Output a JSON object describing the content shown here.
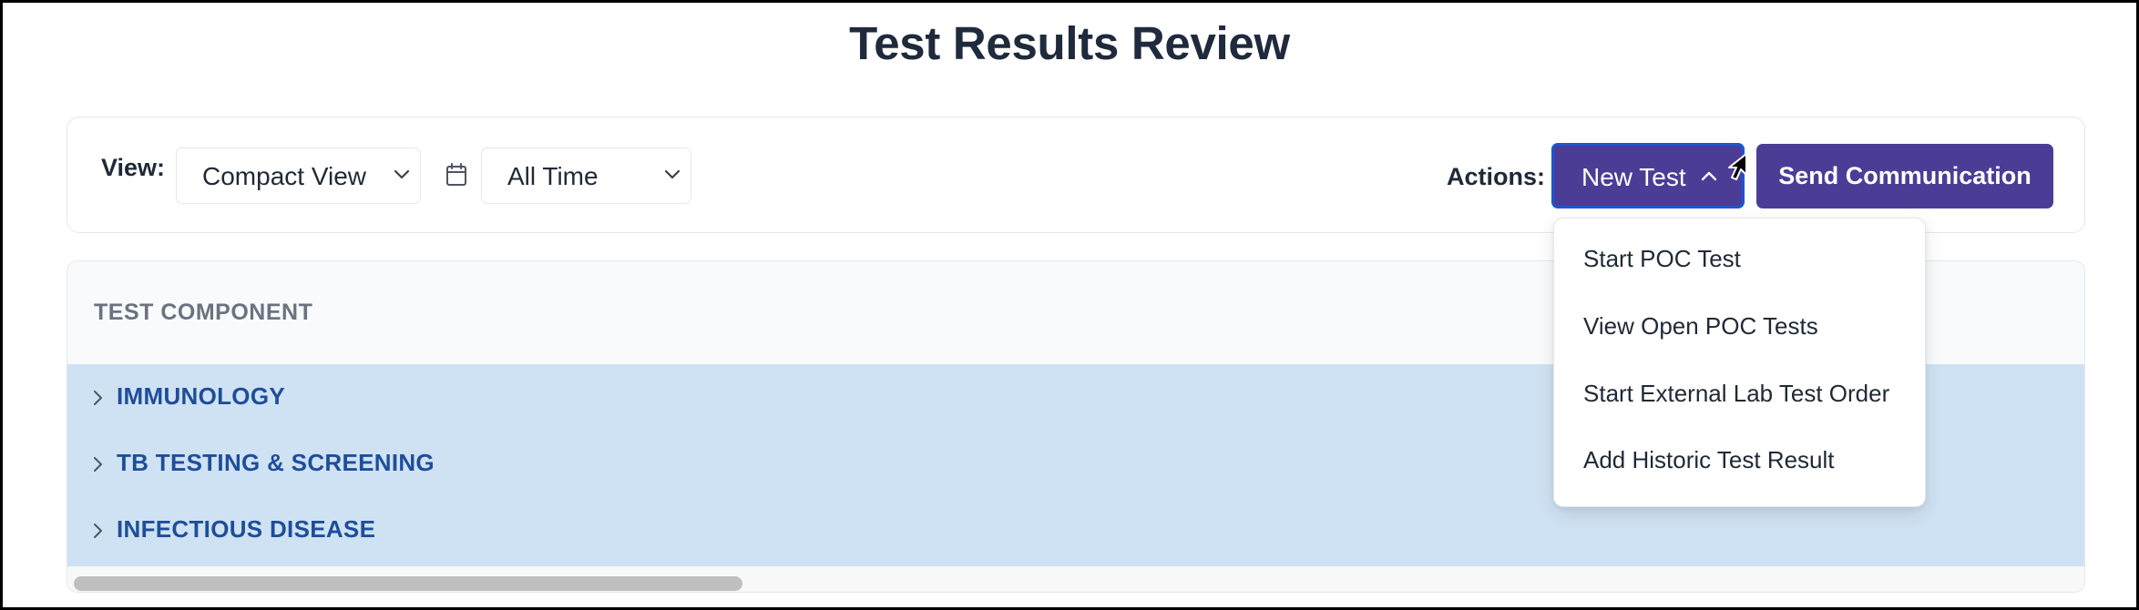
{
  "page": {
    "title": "Test Results Review"
  },
  "toolbar": {
    "view_label": "View:",
    "view_select": {
      "value": "Compact View",
      "icon": "chevron-down-icon"
    },
    "date_icon": "calendar-icon",
    "date_select": {
      "value": "All Time",
      "icon": "chevron-down-icon"
    },
    "actions_label": "Actions:",
    "new_test_button": {
      "label": "New Test",
      "icon": "chevron-up-icon",
      "state": "expanded"
    },
    "send_button": {
      "label": "Send Communication"
    }
  },
  "new_test_menu": {
    "items": [
      "Start POC Test",
      "View Open POC Tests",
      "Start External Lab Test Order",
      "Add Historic Test Result"
    ]
  },
  "table": {
    "column_header": "TEST COMPONENT",
    "groups": [
      {
        "label": "IMMUNOLOGY",
        "icon": "chevron-right-icon",
        "expanded": false
      },
      {
        "label": "TB TESTING & SCREENING",
        "icon": "chevron-right-icon",
        "expanded": false
      },
      {
        "label": "INFECTIOUS DISEASE",
        "icon": "chevron-right-icon",
        "expanded": false
      }
    ]
  },
  "colors": {
    "primary_button": "#4b3d96",
    "focus_ring": "#1c55d4",
    "group_row_bg": "#cfe2f3",
    "group_row_text": "#1e4e9a",
    "header_text": "#6b7280"
  }
}
